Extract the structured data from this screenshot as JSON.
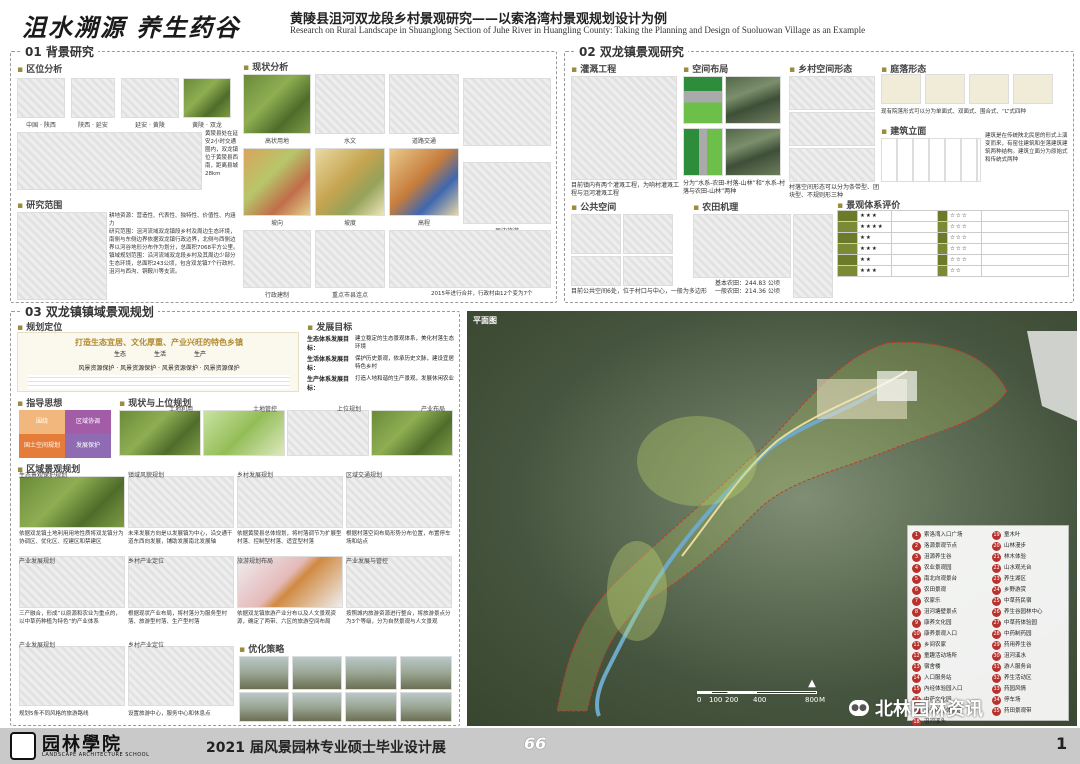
{
  "header": {
    "calligraphy": "沮水溯源 养生药谷",
    "title_cn": "黄陵县沮河双龙段乡村景观研究——以索洛湾村景观规划设计为例",
    "title_en": "Research on Rural Landscape in Shuanglong Section of Juhe River in Huangling County: Taking the Planning and Design of Suoluowan Village as an Example"
  },
  "sec1": {
    "title": "01 背景研究",
    "location_sub": "区位分析",
    "status_sub": "现状分析",
    "range_sub": "研究范围",
    "loc_captions": [
      "中国 · 陕西",
      "陕西 · 延安",
      "延安 · 黄陵",
      "黄陵 · 双龙"
    ],
    "loc_text": "黄陵县处在延安2小时交通圈内，双龙镇位于黄陵县西南，距离县城28km",
    "status_captions": [
      "高状用地",
      "水文",
      "道路交通",
      "坡向",
      "坡度",
      "高程",
      "行政建制",
      "重点市县连点",
      "周边旅游"
    ],
    "range_text": "耕地资源：营造性、代表性、独特性、价值性、内涵力\n研究范围：沮河流域双龙镇段乡村及周边生态环境，南侧与东侧边界依据双龙镇行政边界，北侧与西侧边界以河谷地形分布作为划分，总面积7068平方公里。\n镇域规划范围：沿河流域双龙段乡村及其周边少部分生态环境，总面积243公顷，包含双龙镇7个行政村、沮河与西沟、铜鞍川等支流。",
    "year_note": "2015年进行合并，行政村由12个变为7个"
  },
  "sec2": {
    "title": "02 双龙镇景观研究",
    "irrigation_sub": "灌溉工程",
    "spatial_sub": "空间布局",
    "village_form_sub": "乡村空间形态",
    "courtyard_sub": "庭落形态",
    "building_sub": "建筑立面",
    "public_sub": "公共空间",
    "farm_sub": "农田机理",
    "eval_sub": "景观体系评价",
    "irrigation_text": "目前镇内有两个灌溉工程，为响村灌溉工程与沮河灌溉工程",
    "spatial_text": "分为“水系-农田-村落-山林”和“水系-村落与农田-山林”两种",
    "village_text": "村落空间形态可以分为条带型、团块型、不规则形三种",
    "courtyard_text": "现有院落形式可以分为单面式、双面式、围合式、“L”式四种",
    "building_text": "建筑是在传统陕北民居的形式上演变而来，有窑住建筑和坐落建筑建筑两种结构。建筑立面分为原始式和传统式两种",
    "public_text": "目前公共空间6处，位于村口与中心，一般为多边形",
    "farm_basic": "基本农田：244.83 公顷",
    "farm_general": "一般农田：214.36 公顷",
    "eval_rows": [
      {
        "stars": "★★★",
        "stars2": "☆☆☆"
      },
      {
        "stars": "★★★★",
        "stars2": "☆☆☆"
      },
      {
        "stars": "★★",
        "stars2": "☆☆☆"
      },
      {
        "stars": "★★★",
        "stars2": "☆☆☆"
      },
      {
        "stars": "★★",
        "stars2": "☆☆☆"
      },
      {
        "stars": "★★★",
        "stars2": "☆☆"
      }
    ]
  },
  "sec3": {
    "title": "03 双龙镇镇域景观规划",
    "positioning_sub": "规划定位",
    "goal_sub": "发展目标",
    "guide_sub": "指导思想",
    "status_sub": "现状与上位规划",
    "regional_sub": "区域景观规划",
    "slogan": "打造生态宜居、文化厚重、产业兴旺的特色乡镇",
    "pillars": [
      "生态",
      "生活",
      "生产"
    ],
    "protection_line": "风景资源保护 · 风景资源保护 · 风景资源保护 · 风景资源保护",
    "goals": [
      {
        "k": "生态体系发展目标：",
        "v": "建立稳定的生态景观体系，美化村落生态环境"
      },
      {
        "k": "生活体系发展目标：",
        "v": "保护历史景观，依承历史文脉，建设宜居特色乡村"
      },
      {
        "k": "生产体系发展目标：",
        "v": "打造人地和谐的生产景观，发展休闲农业"
      }
    ],
    "map_labels": [
      "土地利用",
      "土地管控",
      "上位规划",
      "产业布局"
    ],
    "guide_cells": [
      "围绕",
      "区域协调",
      "国土空间规划",
      "发展保护"
    ],
    "plan_titles": [
      "生态景观保护规划",
      "镇域风貌规划",
      "乡村发展规划",
      "区域交通规划",
      "产业发展规划",
      "乡村产业定位",
      "旅游规划布局",
      "产业发展与管控",
      "产业发展规划",
      "乡村产业定位"
    ],
    "texts": [
      "依据双龙镇土地利用用地性质将双龙镇分为协调区、优化区、控建区和禁建区",
      "未来发展方向是以发展镇为中心，沿交通干道东西向发展，铺助发展南北发展轴",
      "依据黄陵县总体规划，将村落调节为扩展型村落、控制型村落、适宜型村落",
      "根据村落空间布局形势分布位置，布置停车场和站点",
      "三产融合，形成“以原源和农业为重点的，以中草药种植为特色”的产业体系",
      "根据现状产业布局，将村落分为服务型村落、旅游型村落、生产型村落",
      "依据双龙镇旅游产业分布以及人文景观资源，确定了两带、六区的旅游空间布局",
      "按照城内旅游资源进行整合，将旅游景点分为3个等级，分为自然景观与人文景观",
      "规划5条不同风格的旅游路线",
      "设置旅游中心，服务中心和休息点"
    ],
    "optimize_sub": "优化策略"
  },
  "plan": {
    "title": "平面图",
    "scale": [
      "0",
      "100",
      "200",
      "400",
      "800"
    ],
    "scale_unit": "M",
    "legend_left": [
      "索洛湾入口广场",
      "洛源景观节点",
      "沮源养生谷",
      "农业景观园",
      "南北向观景台",
      "农田景观",
      "农家乐",
      "沮河塘壁景点",
      "康养文化园",
      "康养景观入口",
      "乡间农家",
      "童趣活动场所",
      "宿舍楼",
      "入口服务站",
      "內经体验园入口",
      "中药文化园",
      "黄帝内经体验园",
      "沮河溪头"
    ],
    "legend_right": [
      "童木叶",
      "山林漫步",
      "林木体验",
      "山水观光台",
      "养生湖区",
      "乡野游赏",
      "中草药民宿",
      "养生谷园林中心",
      "中草药体验园",
      "中药制药园",
      "药用养生谷",
      "沮河溪水",
      "游人服务台",
      "养生活动区",
      "药园风情",
      "停车场",
      "药田景观带"
    ],
    "watermark": "北林园林资讯"
  },
  "footer": {
    "logo_text": "园林學院",
    "logo_en": "LANDSCAPE ARCHITECTURE SCHOOL",
    "exhibit": "2021 届风景园林专业硕士毕业设计展",
    "number": "66",
    "page": "1"
  }
}
